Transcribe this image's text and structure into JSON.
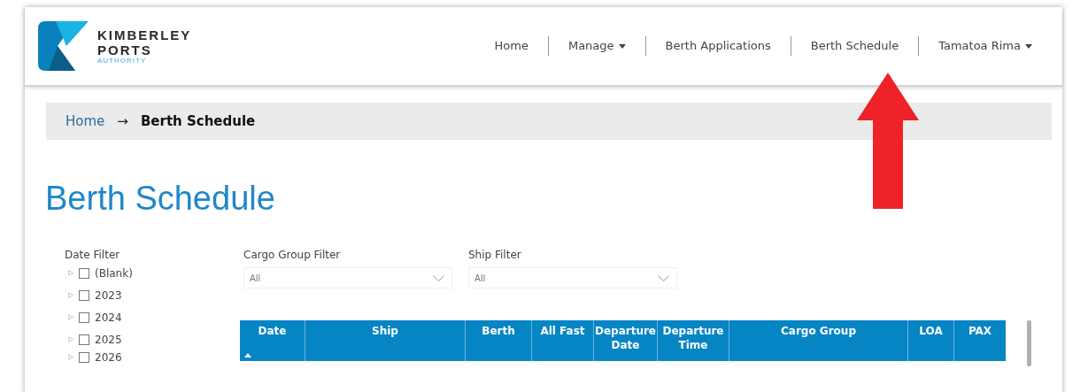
{
  "logo": {
    "lines": [
      "KIMBERLEY",
      "PORTS"
    ],
    "subtitle": "AUTHORITY"
  },
  "nav": [
    {
      "label": "Home",
      "dropdown": false
    },
    {
      "label": "Manage",
      "dropdown": true
    },
    {
      "label": "Berth Applications",
      "dropdown": false
    },
    {
      "label": "Berth Schedule",
      "dropdown": false
    },
    {
      "label": "Tamatoa Rima",
      "dropdown": true
    }
  ],
  "breadcrumb": {
    "home": "Home",
    "separator": "→",
    "current": "Berth Schedule"
  },
  "page_title": "Berth Schedule",
  "date_filter": {
    "label": "Date Filter",
    "items": [
      {
        "label": "(Blank)",
        "checked": false,
        "expanded": false
      },
      {
        "label": "2023",
        "checked": false,
        "expanded": false
      },
      {
        "label": "2024",
        "checked": false,
        "expanded": false
      },
      {
        "label": "2025",
        "checked": false,
        "expanded": false
      },
      {
        "label": "2026",
        "checked": false,
        "expanded": false
      }
    ]
  },
  "dropdown_filters": [
    {
      "label": "Cargo Group Filter",
      "value": "All"
    },
    {
      "label": "Ship Filter",
      "value": "All"
    }
  ],
  "table": {
    "columns": [
      {
        "label": "Date",
        "sorted": true
      },
      {
        "label": "Ship",
        "sorted": false
      },
      {
        "label": "Berth",
        "sorted": false
      },
      {
        "label": "All Fast",
        "sorted": false
      },
      {
        "label": "Departure Date",
        "sorted": false
      },
      {
        "label": "Departure Time",
        "sorted": false
      },
      {
        "label": "Cargo Group",
        "sorted": false
      },
      {
        "label": "LOA",
        "sorted": false
      },
      {
        "label": "PAX",
        "sorted": false
      }
    ]
  },
  "annotation": {
    "kind": "arrow"
  }
}
